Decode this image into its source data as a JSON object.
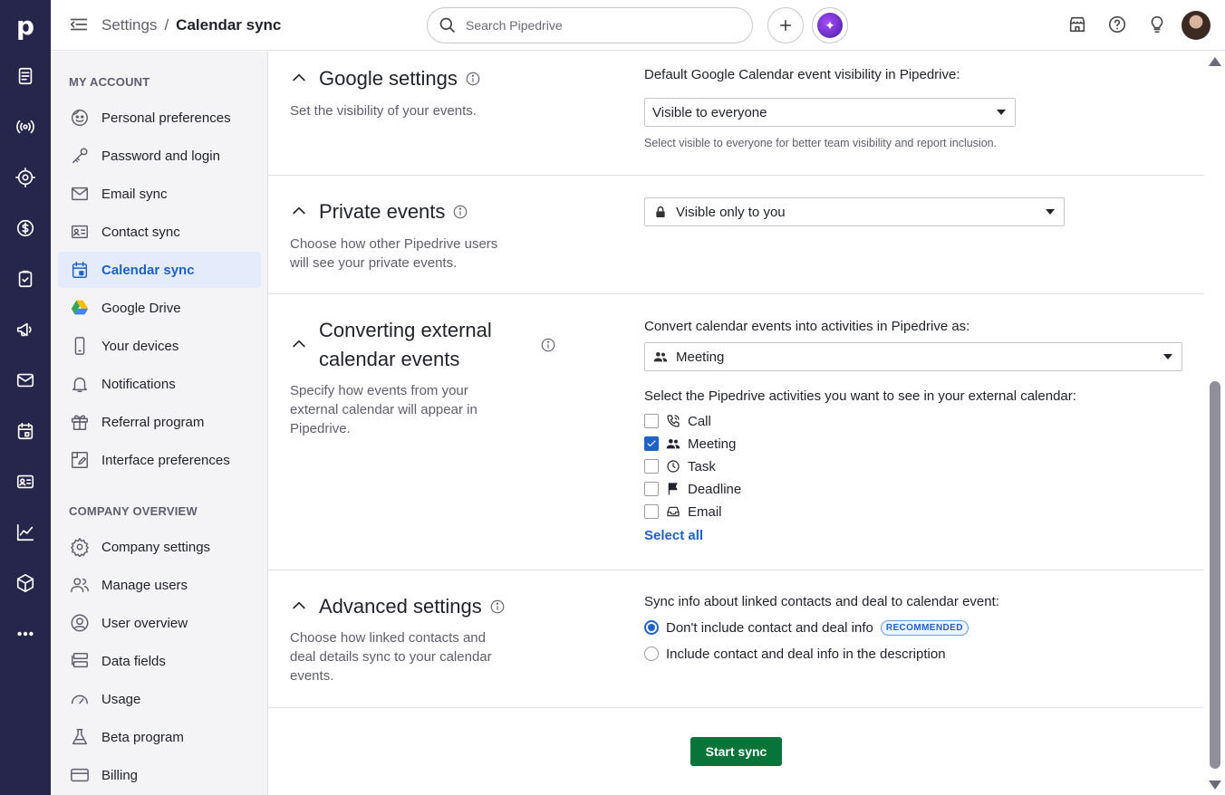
{
  "app": {
    "logo": "p"
  },
  "header": {
    "breadcrumb_parent": "Settings",
    "breadcrumb_separator": "/",
    "breadcrumb_current": "Calendar sync",
    "search_placeholder": "Search Pipedrive"
  },
  "sidebar": {
    "my_account_heading": "MY ACCOUNT",
    "my_account_items": [
      {
        "label": "Personal preferences",
        "icon": "smiley-icon"
      },
      {
        "label": "Password and login",
        "icon": "key-icon"
      },
      {
        "label": "Email sync",
        "icon": "envelope-icon"
      },
      {
        "label": "Contact sync",
        "icon": "contact-card-icon"
      },
      {
        "label": "Calendar sync",
        "icon": "calendar-icon",
        "active": true
      },
      {
        "label": "Google Drive",
        "icon": "google-drive-icon"
      },
      {
        "label": "Your devices",
        "icon": "phone-icon"
      },
      {
        "label": "Notifications",
        "icon": "bell-icon"
      },
      {
        "label": "Referral program",
        "icon": "gift-icon"
      },
      {
        "label": "Interface preferences",
        "icon": "interface-icon"
      }
    ],
    "company_heading": "COMPANY OVERVIEW",
    "company_items": [
      {
        "label": "Company settings",
        "icon": "gear-icon"
      },
      {
        "label": "Manage users",
        "icon": "users-icon"
      },
      {
        "label": "User overview",
        "icon": "user-circle-icon"
      },
      {
        "label": "Data fields",
        "icon": "data-fields-icon"
      },
      {
        "label": "Usage",
        "icon": "gauge-icon"
      },
      {
        "label": "Beta program",
        "icon": "flask-icon"
      },
      {
        "label": "Billing",
        "icon": "credit-card-icon"
      }
    ]
  },
  "sections": {
    "google": {
      "title": "Google settings",
      "description": "Set the visibility of your events.",
      "field_label": "Default Google Calendar event visibility in Pipedrive:",
      "select_value": "Visible to everyone",
      "hint": "Select visible to everyone for better team visibility and report inclusion."
    },
    "private": {
      "title": "Private events",
      "description_line1": "Choose how other Pipedrive users",
      "description_line2": "will see your private events.",
      "select_value": "Visible only to you"
    },
    "converting": {
      "title_line1": "Converting external",
      "title_line2": "calendar events",
      "description_line1": "Specify how events from your",
      "description_line2": "external calendar will appear in",
      "description_line3": "Pipedrive.",
      "field_label": "Convert calendar events into activities in Pipedrive as:",
      "select_value": "Meeting",
      "activities_label": "Select the Pipedrive activities you want to see in your external calendar:",
      "activities": [
        {
          "label": "Call",
          "checked": false,
          "icon": "phone-call-icon"
        },
        {
          "label": "Meeting",
          "checked": true,
          "icon": "meeting-icon"
        },
        {
          "label": "Task",
          "checked": false,
          "icon": "clock-icon"
        },
        {
          "label": "Deadline",
          "checked": false,
          "icon": "flag-icon"
        },
        {
          "label": "Email",
          "checked": false,
          "icon": "inbox-icon"
        }
      ],
      "select_all": "Select all"
    },
    "advanced": {
      "title": "Advanced settings",
      "description_line1": "Choose how linked contacts and",
      "description_line2": "deal details sync to your calendar",
      "description_line3": "events.",
      "field_label": "Sync info about linked contacts and deal to calendar event:",
      "option1": "Don't include contact and deal info",
      "option1_badge": "RECOMMENDED",
      "option2": "Include contact and deal info in the description",
      "selected_option": 1
    }
  },
  "actions": {
    "start_sync": "Start sync"
  },
  "colors": {
    "rail": "#26254b",
    "accent": "#1e62c7",
    "primary_button": "#08743a",
    "active_item_bg": "#e4ecfb"
  }
}
